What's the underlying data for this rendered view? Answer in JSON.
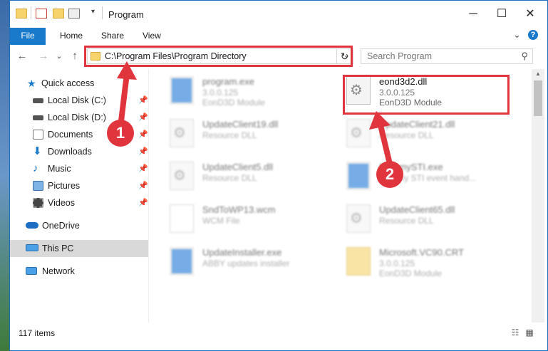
{
  "window": {
    "title": "Program",
    "minimize": "─",
    "maximize": "☐",
    "close": "✕"
  },
  "ribbon": {
    "tabs": [
      "File",
      "Home",
      "Share",
      "View"
    ],
    "expand": "⌄",
    "help": "?"
  },
  "nav": {
    "back": "←",
    "forward": "→",
    "recent": "⌄",
    "up": "↑"
  },
  "address": {
    "path": "C:\\Program Files\\Program Directory",
    "chevron": "⌄",
    "refresh": "↻"
  },
  "search": {
    "placeholder": "Search Program",
    "icon": "⚲"
  },
  "sidebar": {
    "quick_access": "Quick access",
    "items": [
      {
        "label": "Local Disk (C:)",
        "icon": "drive-icon"
      },
      {
        "label": "Local Disk (D:)",
        "icon": "drive-icon"
      },
      {
        "label": "Documents",
        "icon": "documents-icon"
      },
      {
        "label": "Downloads",
        "icon": "downloads-icon"
      },
      {
        "label": "Music",
        "icon": "music-icon"
      },
      {
        "label": "Pictures",
        "icon": "pictures-icon"
      },
      {
        "label": "Videos",
        "icon": "videos-icon"
      }
    ],
    "pin": "📌",
    "onedrive": "OneDrive",
    "this_pc": "This PC",
    "network": "Network"
  },
  "files": [
    {
      "name": "program.exe",
      "line1": "3.0.0.125",
      "line2": "EonD3D Module",
      "icon": "app",
      "blurred": true
    },
    {
      "name": "eond3d2.dll",
      "line1": "3.0.0.125",
      "line2": "EonD3D Module",
      "icon": "gear",
      "blurred": false
    },
    {
      "name": "UpdateClient19.dll",
      "line1": "Resource DLL",
      "line2": "",
      "icon": "gear",
      "blurred": true
    },
    {
      "name": "UpdateClient21.dll",
      "line1": "Resource DLL",
      "line2": "",
      "icon": "gear",
      "blurred": true
    },
    {
      "name": "UpdateClient5.dll",
      "line1": "Resource DLL",
      "line2": "",
      "icon": "gear",
      "blurred": true
    },
    {
      "name": "DummySTI.exe",
      "line1": "Dummy STI event hand...",
      "line2": "",
      "icon": "app",
      "blurred": true
    },
    {
      "name": "SndToWP13.wcm",
      "line1": "WCM File",
      "line2": "",
      "icon": "doc",
      "blurred": true
    },
    {
      "name": "UpdateClient65.dll",
      "line1": "Resource DLL",
      "line2": "",
      "icon": "gear",
      "blurred": true
    },
    {
      "name": "UpdateInstaller.exe",
      "line1": "ABBY updates installer",
      "line2": "",
      "icon": "app",
      "blurred": true
    },
    {
      "name": "Microsoft.VC90.CRT",
      "line1": "3.0.0.125",
      "line2": "EonD3D Module",
      "icon": "folder",
      "blurred": true
    }
  ],
  "status": {
    "count": "117 items"
  },
  "markers": {
    "one": "1",
    "two": "2"
  },
  "colors": {
    "accent": "#1979ca",
    "highlight": "#e1353d"
  }
}
